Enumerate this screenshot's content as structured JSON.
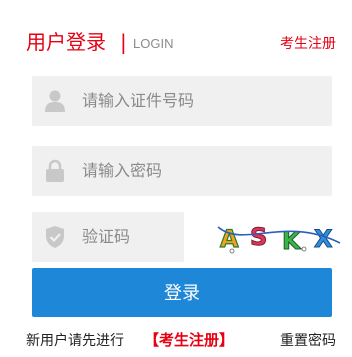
{
  "header": {
    "title": "用户登录",
    "separator": "|",
    "subtitle": "LOGIN",
    "register_link": "考生注册"
  },
  "form": {
    "id_placeholder": "请输入证件号码",
    "password_placeholder": "请输入密码",
    "captcha_placeholder": "验证码",
    "captcha_text": "ASKX",
    "login_label": "登录"
  },
  "footer": {
    "prompt": "新用户请先进行",
    "register_link": "【考生注册】",
    "reset_link": "重置密码"
  },
  "colors": {
    "accent_red": "#e60012",
    "button_blue": "#1e87d8",
    "field_bg": "#f0f0f0"
  },
  "icons": {
    "id_field": "user-icon",
    "password_field": "lock-icon",
    "captcha_field": "shield-icon"
  }
}
